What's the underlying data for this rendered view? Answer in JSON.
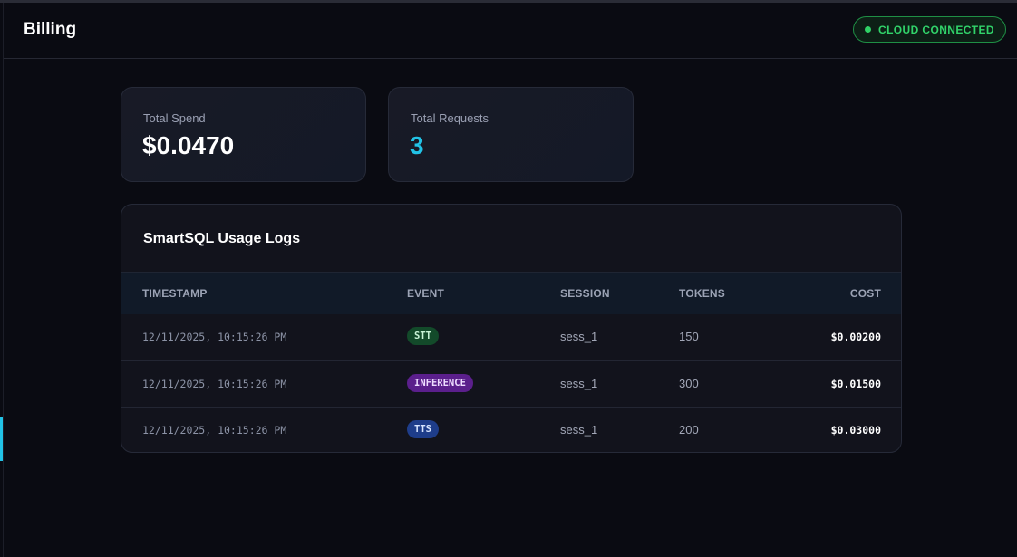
{
  "header": {
    "title": "Billing",
    "status": "CLOUD CONNECTED"
  },
  "colors": {
    "accent_cyan": "#22c3e6",
    "status_green": "#31d36a",
    "stt": "#134a2a",
    "inference": "#5b1f8c",
    "tts": "#1e3d8a"
  },
  "stats": {
    "total_spend_label": "Total Spend",
    "total_spend_value": "$0.0470",
    "total_requests_label": "Total Requests",
    "total_requests_value": "3"
  },
  "logs": {
    "title": "SmartSQL Usage Logs",
    "columns": {
      "timestamp": "TIMESTAMP",
      "event": "EVENT",
      "session": "SESSION",
      "tokens": "TOKENS",
      "cost": "COST"
    },
    "rows": [
      {
        "timestamp": "12/11/2025, 10:15:26 PM",
        "event": "STT",
        "session": "sess_1",
        "tokens": "150",
        "cost": "$0.00200"
      },
      {
        "timestamp": "12/11/2025, 10:15:26 PM",
        "event": "INFERENCE",
        "session": "sess_1",
        "tokens": "300",
        "cost": "$0.01500"
      },
      {
        "timestamp": "12/11/2025, 10:15:26 PM",
        "event": "TTS",
        "session": "sess_1",
        "tokens": "200",
        "cost": "$0.03000"
      }
    ]
  }
}
